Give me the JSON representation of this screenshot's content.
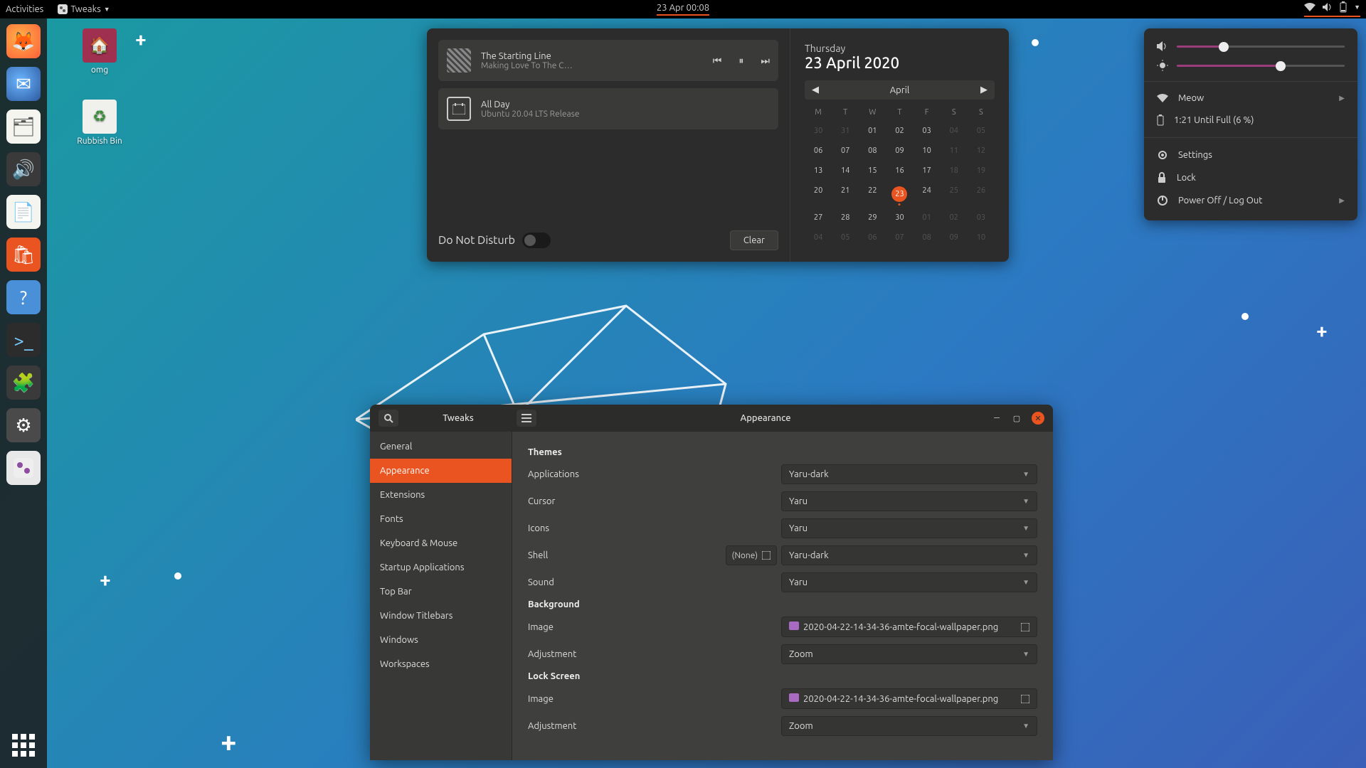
{
  "topbar": {
    "activities": "Activities",
    "app_menu": "Tweaks",
    "clock": "23 Apr  00:08"
  },
  "desktop_icons": {
    "home": "omg",
    "trash": "Rubbish Bin"
  },
  "notif_popover": {
    "media": {
      "title": "The Starting Line",
      "subtitle": "Making Love To The C…"
    },
    "event": {
      "time": "All Day",
      "title": "Ubuntu 20.04 LTS Release"
    },
    "dnd_label": "Do Not Disturb",
    "clear_label": "Clear"
  },
  "calendar": {
    "weekday": "Thursday",
    "full_date": "23 April 2020",
    "month_label": "April",
    "dow": [
      "M",
      "T",
      "W",
      "T",
      "F",
      "S",
      "S"
    ],
    "weeks": [
      [
        {
          "d": "30",
          "dim": true
        },
        {
          "d": "31",
          "dim": true
        },
        {
          "d": "01"
        },
        {
          "d": "02"
        },
        {
          "d": "03"
        },
        {
          "d": "04",
          "dim": true
        },
        {
          "d": "05",
          "dim": true
        }
      ],
      [
        {
          "d": "06"
        },
        {
          "d": "07"
        },
        {
          "d": "08"
        },
        {
          "d": "09"
        },
        {
          "d": "10"
        },
        {
          "d": "11",
          "dim": true
        },
        {
          "d": "12",
          "dim": true
        }
      ],
      [
        {
          "d": "13"
        },
        {
          "d": "14"
        },
        {
          "d": "15"
        },
        {
          "d": "16"
        },
        {
          "d": "17"
        },
        {
          "d": "18",
          "dim": true
        },
        {
          "d": "19",
          "dim": true
        }
      ],
      [
        {
          "d": "20"
        },
        {
          "d": "21"
        },
        {
          "d": "22"
        },
        {
          "d": "23",
          "today": true,
          "evt": true
        },
        {
          "d": "24"
        },
        {
          "d": "25",
          "dim": true
        },
        {
          "d": "26",
          "dim": true
        }
      ],
      [
        {
          "d": "27"
        },
        {
          "d": "28"
        },
        {
          "d": "29"
        },
        {
          "d": "30"
        },
        {
          "d": "01",
          "dim": true
        },
        {
          "d": "02",
          "dim": true
        },
        {
          "d": "03",
          "dim": true
        }
      ],
      [
        {
          "d": "04",
          "dim": true
        },
        {
          "d": "05",
          "dim": true
        },
        {
          "d": "06",
          "dim": true
        },
        {
          "d": "07",
          "dim": true
        },
        {
          "d": "08",
          "dim": true
        },
        {
          "d": "09",
          "dim": true
        },
        {
          "d": "10",
          "dim": true
        }
      ]
    ]
  },
  "sysmenu": {
    "volume_pct": 28,
    "brightness_pct": 62,
    "wifi": "Meow",
    "battery": "1:21 Until Full (6 %)",
    "settings": "Settings",
    "lock": "Lock",
    "power": "Power Off / Log Out"
  },
  "tweaks": {
    "title_left": "Tweaks",
    "title_right": "Appearance",
    "sidebar": [
      "General",
      "Appearance",
      "Extensions",
      "Fonts",
      "Keyboard & Mouse",
      "Startup Applications",
      "Top Bar",
      "Window Titlebars",
      "Windows",
      "Workspaces"
    ],
    "sidebar_active_index": 1,
    "sections": {
      "themes": {
        "heading": "Themes",
        "rows": {
          "apps": {
            "label": "Applications",
            "value": "Yaru-dark"
          },
          "cursor": {
            "label": "Cursor",
            "value": "Yaru"
          },
          "icons": {
            "label": "Icons",
            "value": "Yaru"
          },
          "shell": {
            "label": "Shell",
            "value": "Yaru-dark",
            "none_btn": "(None)"
          },
          "sound": {
            "label": "Sound",
            "value": "Yaru"
          }
        }
      },
      "background": {
        "heading": "Background",
        "image_label": "Image",
        "image_value": "2020-04-22-14-34-36-amte-focal-wallpaper.png",
        "adjust_label": "Adjustment",
        "adjust_value": "Zoom"
      },
      "lockscreen": {
        "heading": "Lock Screen",
        "image_label": "Image",
        "image_value": "2020-04-22-14-34-36-amte-focal-wallpaper.png",
        "adjust_label": "Adjustment",
        "adjust_value": "Zoom"
      }
    }
  }
}
